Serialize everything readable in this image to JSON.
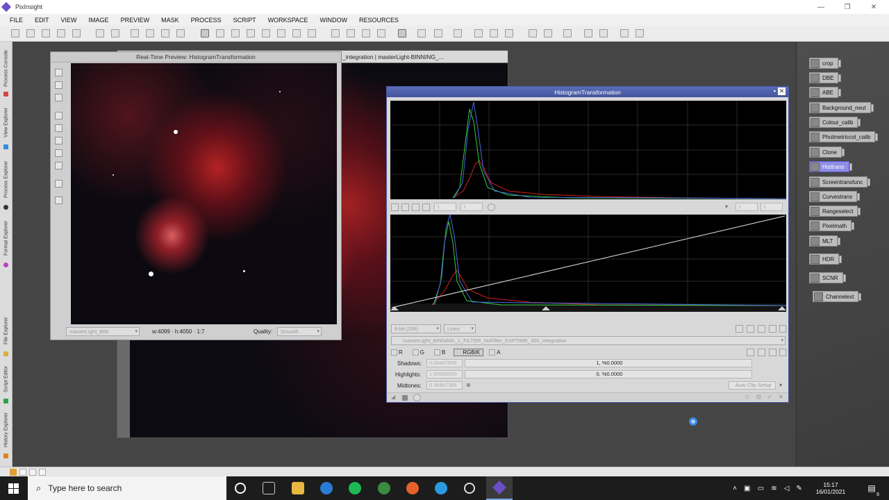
{
  "app": {
    "title": "PixInsight"
  },
  "window_controls": {
    "minimize": "—",
    "maximize": "❐",
    "close": "✕"
  },
  "menu": [
    "FILE",
    "EDIT",
    "VIEW",
    "IMAGE",
    "PREVIEW",
    "MASK",
    "PROCESS",
    "SCRIPT",
    "WORKSPACE",
    "WINDOW",
    "RESOURCES"
  ],
  "left_tabs": [
    "Process Console",
    "View Explorer",
    "Process Explorer",
    "Format Explorer",
    "File Explorer",
    "Script Editor",
    "History Explorer"
  ],
  "image_window": {
    "title": "_integration | masterLight-BINNING_..."
  },
  "preview": {
    "title": "Real-Time Preview: HistogramTransformation",
    "view_select": "masterLight_BIN",
    "dims": "w:4099 · h:4050 · 1:7",
    "quality_label": "Quality:",
    "quality_value": "Smooth"
  },
  "histogram": {
    "title": "HistogramTransformation",
    "zoom_x": "1",
    "zoom_y": "1",
    "zoom_x2": "1",
    "zoom_y2": "1",
    "bitdepth": "8-bit (256)",
    "graph_style": "Lines",
    "view_name": "masterLight_BINNING_1_FILTER_NoFilter_EXPTIME_300_integration",
    "channels": {
      "r": "R",
      "g": "G",
      "b": "B",
      "rgbk": "RGB/K",
      "a": "A"
    },
    "shadows_label": "Shadows:",
    "shadows_value": "0.00467836",
    "shadows_clip": "1, %0.0000",
    "highlights_label": "Highlights:",
    "highlights_value": "1.00000000",
    "highlights_clip": "0, %0.0000",
    "midtones_label": "Midtones:",
    "midtones_value": "0.38947368",
    "auto_clip": "Auto Clip Setup"
  },
  "process_icons": [
    {
      "label": "crop",
      "active": false
    },
    {
      "label": "DBE",
      "active": false
    },
    {
      "label": "ABE",
      "active": false
    },
    {
      "label": "Background_neut",
      "active": false
    },
    {
      "label": "Colour_calib",
      "active": false
    },
    {
      "label": "Photmetriccol_calib",
      "active": false
    },
    {
      "label": "Clone",
      "active": false
    },
    {
      "label": "Histtrans",
      "active": true
    },
    {
      "label": "Screentransfunc",
      "active": false
    },
    {
      "label": "Curvestrans",
      "active": false
    },
    {
      "label": "Rangeselect",
      "active": false
    },
    {
      "label": "Pixelmath",
      "active": false
    },
    {
      "label": "MLT",
      "active": false
    },
    {
      "label": "HDR",
      "active": false
    },
    {
      "label": "SCNR",
      "active": false
    },
    {
      "label": "Channelext",
      "active": false
    }
  ],
  "taskbar": {
    "search_placeholder": "Type here to search",
    "time": "15:17",
    "date": "16/01/2021",
    "notifications": "6"
  },
  "colors": {
    "accent": "#4a5aa8",
    "active_icon": "#8e8de6",
    "nebula_red": "#c0202a"
  }
}
